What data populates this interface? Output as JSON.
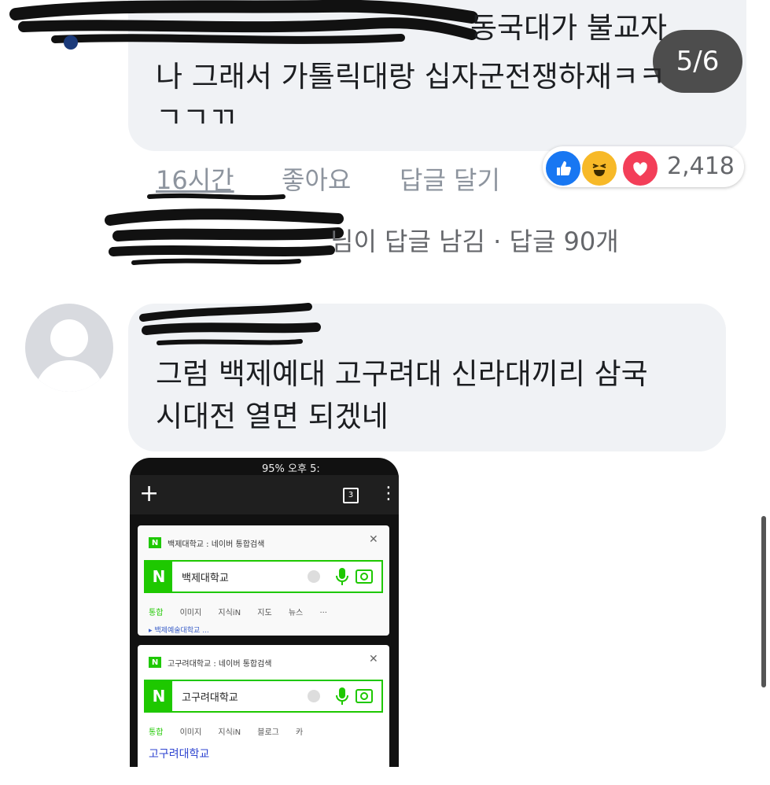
{
  "pager": {
    "label": "5/6"
  },
  "comment1": {
    "line1": "동국대가 불교자",
    "line2": "나 그래서 가톨릭대랑 십자군전쟁하재ㅋㅋ",
    "line3": "ㄱㄱㄲ",
    "time": "16시간",
    "like": "좋아요",
    "reply": "답글 달기",
    "reaction_count": "2,418",
    "reaction_icons": [
      "like-icon",
      "haha-icon",
      "love-icon"
    ],
    "reaction_colors": {
      "like": "#1877f2",
      "haha": "#f7b928",
      "love": "#f33e58"
    }
  },
  "replies": {
    "summary_partial": "님이 답글 남김 · 답글 90개"
  },
  "comment2": {
    "line1": "그럼 백제예대 고구려대 신라대끼리 삼국",
    "line2": "시대전 열면 되겠네"
  },
  "phone": {
    "status": "95% 오후 5:",
    "tab_count": "3",
    "card1": {
      "title": "백제대학교 : 네이버 통합검색",
      "query": "백제대학교",
      "tabs": [
        "통합",
        "이미지",
        "지식iN",
        "지도",
        "뉴스",
        "···"
      ],
      "result_partial": "▸ 백제예술대학교 ..."
    },
    "card2": {
      "title": "고구려대학교 : 네이버 통합검색",
      "query": "고구려대학교",
      "tabs": [
        "통합",
        "이미지",
        "지식iN",
        "블로그",
        "카"
      ],
      "result": "고구려대학교"
    },
    "brand_color": "#1ec800"
  }
}
